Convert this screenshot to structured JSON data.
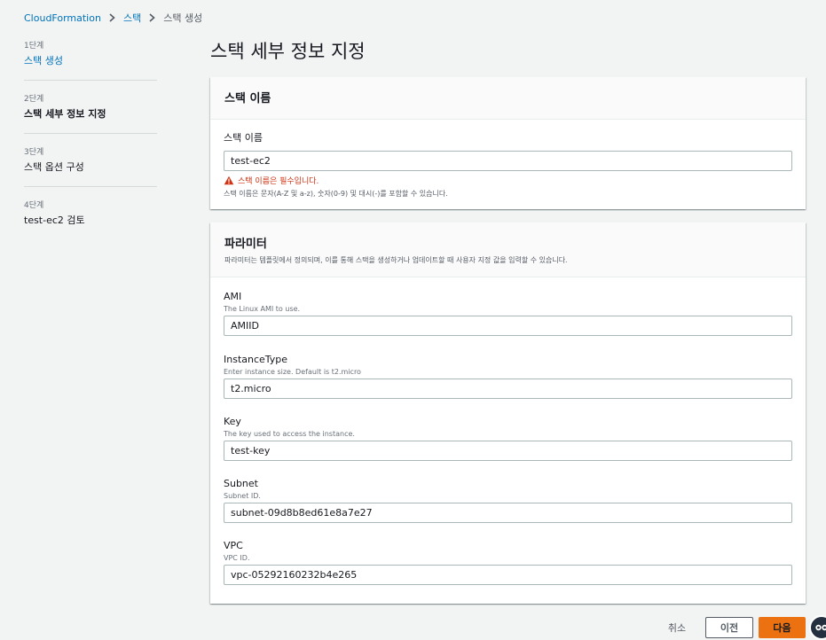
{
  "breadcrumb": {
    "root": "CloudFormation",
    "stacks": "스택",
    "current": "스택 생성"
  },
  "steps": [
    {
      "num": "1단계",
      "name": "스택 생성"
    },
    {
      "num": "2단계",
      "name": "스택 세부 정보 지정"
    },
    {
      "num": "3단계",
      "name": "스택 옵션 구성"
    },
    {
      "num": "4단계",
      "name": "test-ec2 검토"
    }
  ],
  "page_title": "스택 세부 정보 지정",
  "stack_name_panel": {
    "title": "스택 이름",
    "field_label": "스택 이름",
    "value": "test-ec2",
    "error": "스택 이름은 필수입니다.",
    "hint": "스택 이름은 문자(A-Z 및 a-z), 숫자(0-9) 및 대시(-)를 포함할 수 있습니다."
  },
  "params_panel": {
    "title": "파라미터",
    "desc": "파라미터는 템플릿에서 정의되며, 이를 통해 스택을 생성하거나 업데이트할 때 사용자 지정 값을 입력할 수 있습니다.",
    "fields": [
      {
        "label": "AMI",
        "sub": "The Linux AMI to use.",
        "value": "AMIID"
      },
      {
        "label": "InstanceType",
        "sub": "Enter instance size. Default is t2.micro",
        "value": "t2.micro"
      },
      {
        "label": "Key",
        "sub": "The key used to access the instance.",
        "value": "test-key"
      },
      {
        "label": "Subnet",
        "sub": "Subnet ID.",
        "value": "subnet-09d8b8ed61e8a7e27"
      },
      {
        "label": "VPC",
        "sub": "VPC ID.",
        "value": "vpc-05292160232b4e265"
      }
    ]
  },
  "footer": {
    "cancel": "취소",
    "previous": "이전",
    "next": "다음"
  },
  "colors": {
    "link": "#0073bb",
    "primary": "#ec7211",
    "error": "#d13212",
    "background": "#f2f3f3"
  }
}
